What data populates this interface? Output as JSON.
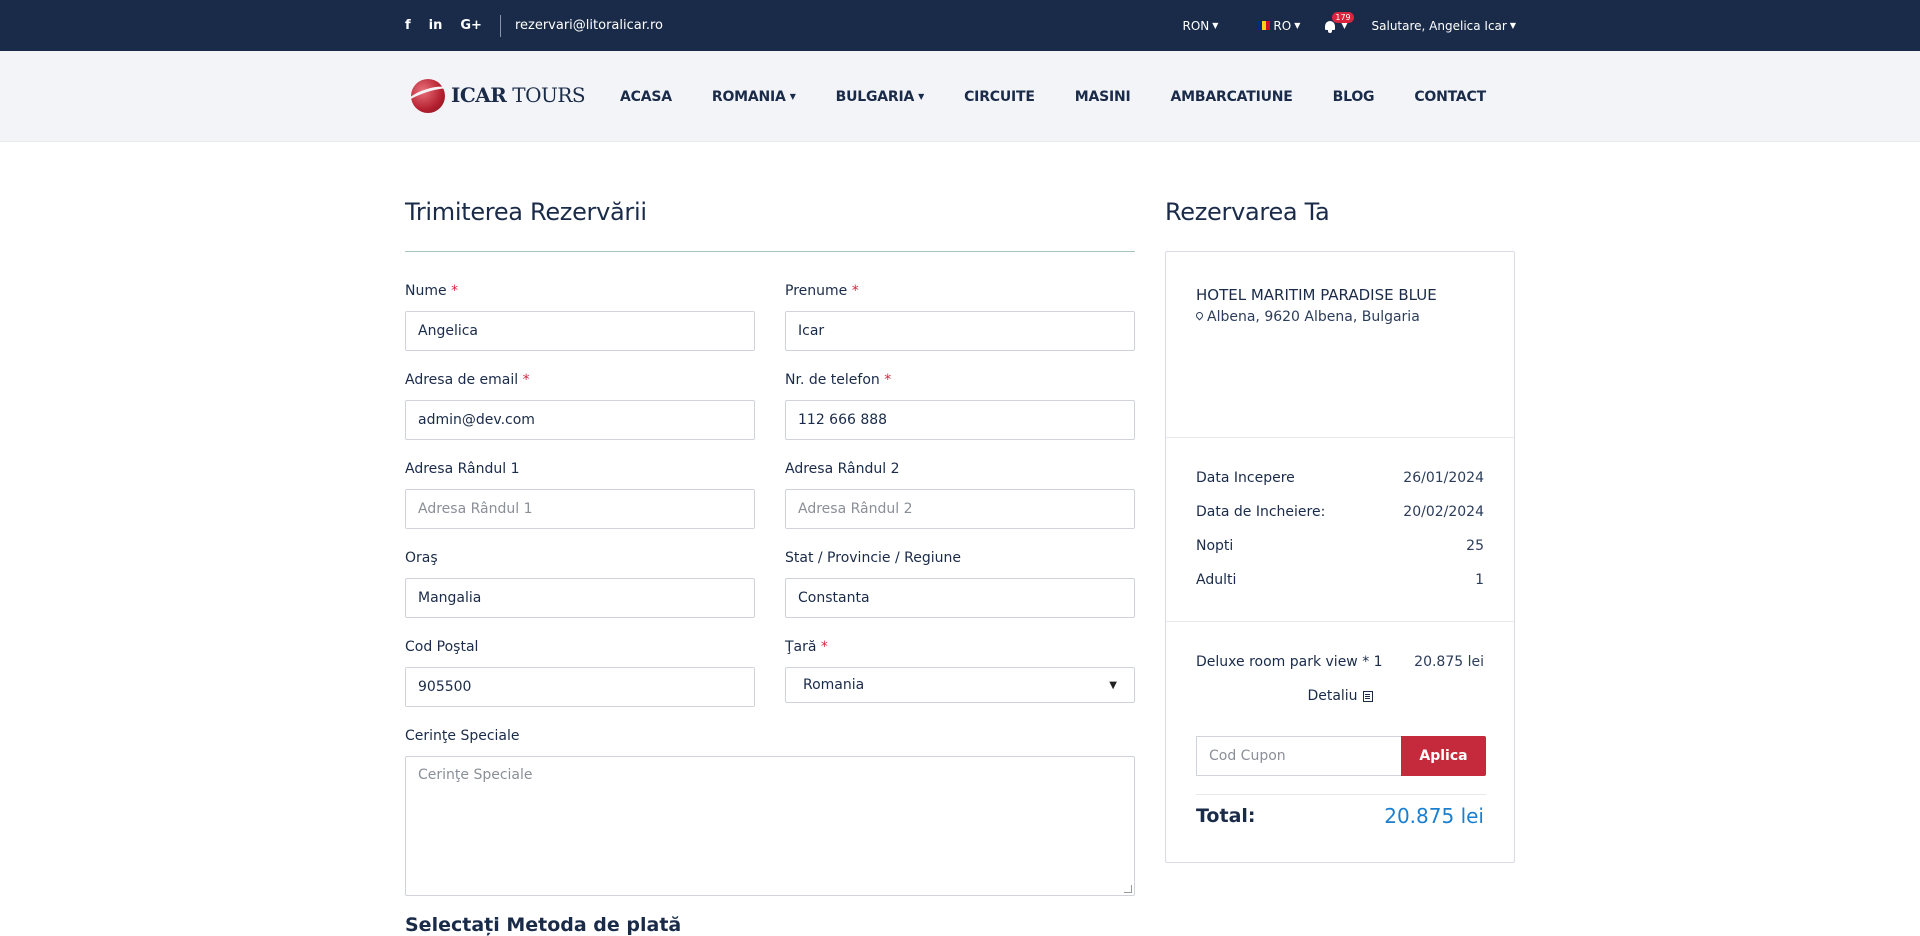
{
  "topbar": {
    "social": [
      "f",
      "in",
      "G+"
    ],
    "email": "rezervari@litoralicar.ro",
    "currency": "RON",
    "language": "RO",
    "notification_count": "179",
    "greeting": "Salutare, Angelica Icar"
  },
  "logo": {
    "brand_bold": "ICAR",
    "brand_rest": " TOURS"
  },
  "nav": [
    "ACASA",
    "ROMANIA",
    "BULGARIA",
    "CIRCUITE",
    "MASINI",
    "AMBARCATIUNE",
    "BLOG",
    "CONTACT"
  ],
  "form": {
    "title": "Trimiterea Rezervării",
    "nume_label": "Nume",
    "nume_value": "Angelica",
    "prenume_label": "Prenume",
    "prenume_value": "Icar",
    "email_label": "Adresa de email",
    "email_value": "admin@dev.com",
    "phone_label": "Nr. de telefon",
    "phone_value": "112 666 888",
    "addr1_label": "Adresa Rândul 1",
    "addr1_placeholder": "Adresa Rândul 1",
    "addr2_label": "Adresa Rândul 2",
    "addr2_placeholder": "Adresa Rândul 2",
    "city_label": "Oraş",
    "city_value": "Mangalia",
    "state_label": "Stat / Provincie / Regiune",
    "state_value": "Constanta",
    "zip_label": "Cod Poştal",
    "zip_value": "905500",
    "country_label": "Ţară",
    "country_value": "Romania",
    "special_label": "Cerinţe Speciale",
    "special_placeholder": "Cerinţe Speciale",
    "required_mark": "*",
    "payment_title": "Selectați Metoda de plată"
  },
  "booking": {
    "title": "Rezervarea Ta",
    "hotel_name": "HOTEL MARITIM PARADISE BLUE",
    "hotel_address": "Albena, 9620 Albena, Bulgaria",
    "start_label": "Data Incepere",
    "start_value": "26/01/2024",
    "end_label": "Data de Incheiere:",
    "end_value": "20/02/2024",
    "nights_label": "Nopti",
    "nights_value": "25",
    "adults_label": "Adulti",
    "adults_value": "1",
    "room_label": "Deluxe room park view * 1",
    "room_price": "20.875 lei",
    "detail_label": "Detaliu",
    "coupon_placeholder": "Cod Cupon",
    "coupon_button": "Aplica",
    "total_label": "Total:",
    "total_value": "20.875 lei"
  },
  "colors": {
    "header_bg": "#1a2b49",
    "nav_bg": "#f3f4f7",
    "accent_red": "#c42a3c",
    "total_blue": "#1a7fd0"
  }
}
